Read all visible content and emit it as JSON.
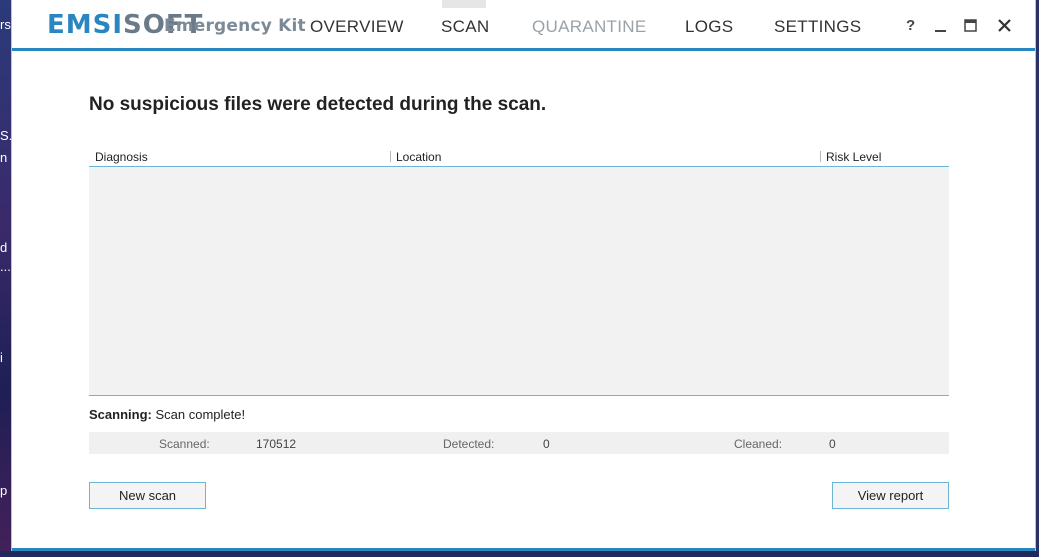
{
  "app": {
    "brand_part1": "EMSI",
    "brand_part2": "SOFT",
    "brand_sub": "Emergency Kit",
    "brand_color": "#2a86c0"
  },
  "nav": {
    "overview": "OVERVIEW",
    "scan": "SCAN",
    "quarantine": "QUARANTINE",
    "logs": "LOGS",
    "settings": "SETTINGS",
    "active": "SCAN"
  },
  "window_controls": {
    "help": "?",
    "minimize": "_",
    "maximize": "□",
    "close": "✕"
  },
  "main": {
    "title": "No suspicious files were detected during the scan."
  },
  "table": {
    "columns": [
      "Diagnosis",
      "Location",
      "Risk Level"
    ],
    "rows": []
  },
  "status": {
    "label": "Scanning:",
    "value": "Scan complete!"
  },
  "stats": {
    "scanned_label": "Scanned:",
    "scanned_value": "170512",
    "detected_label": "Detected:",
    "detected_value": "0",
    "cleaned_label": "Cleaned:",
    "cleaned_value": "0"
  },
  "buttons": {
    "new_scan": "New scan",
    "view_report": "View report"
  },
  "desktop_fragments": [
    "rs",
    "S.",
    "n",
    "d",
    "...",
    "i",
    "p"
  ]
}
